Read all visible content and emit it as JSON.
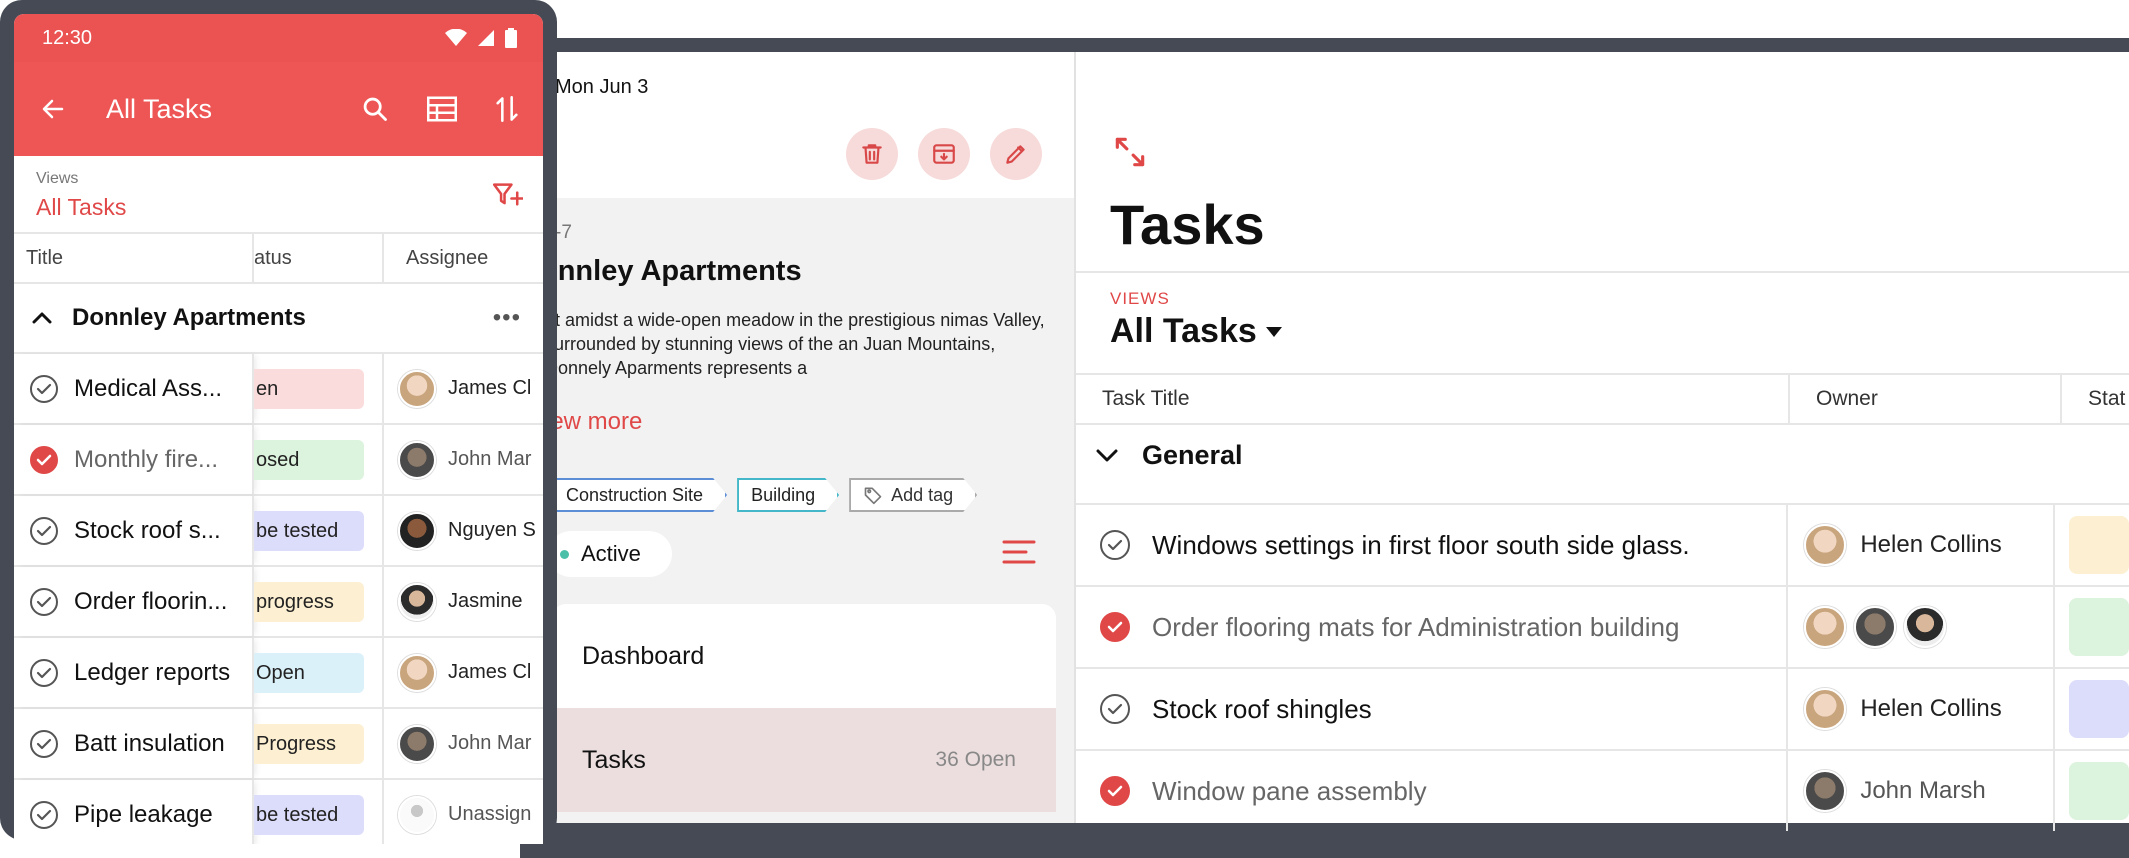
{
  "phone": {
    "status_bar": {
      "time": "12:30"
    },
    "app_bar": {
      "title": "All Tasks"
    },
    "views": {
      "label": "Views",
      "value": "All Tasks"
    },
    "columns": {
      "title": "Title",
      "status": "atus",
      "assignee": "Assignee"
    },
    "group": {
      "label": "Donnley Apartments",
      "more": "•••"
    },
    "rows": [
      {
        "title": "Medical Ass...",
        "done": false,
        "status": "en",
        "status_color": "#fbdcdc",
        "assignee": "James Cl",
        "avatar": "helen"
      },
      {
        "title": "Monthly fire...",
        "done": true,
        "status": "osed",
        "status_color": "#dcf3dd",
        "assignee": "John Mar",
        "avatar": "john"
      },
      {
        "title": "Stock roof s...",
        "done": false,
        "status": "be tested",
        "status_color": "#dcdcfb",
        "assignee": "Nguyen S",
        "avatar": "nguyen"
      },
      {
        "title": "Order floorin...",
        "done": false,
        "status": "progress",
        "status_color": "#fdf0d2",
        "assignee": "Jasmine",
        "avatar": "jas"
      },
      {
        "title": "Ledger reports",
        "done": false,
        "status": "Open",
        "status_color": "#daf1fa",
        "assignee": "James Cl",
        "avatar": "helen"
      },
      {
        "title": "Batt insulation",
        "done": false,
        "status": "Progress",
        "status_color": "#fdf0d2",
        "assignee": "John Mar",
        "avatar": "john"
      },
      {
        "title": "Pipe leakage",
        "done": false,
        "status": "be tested",
        "status_color": "#dcdcfb",
        "assignee": "Unassign",
        "avatar": "un"
      }
    ]
  },
  "project": {
    "date": "Mon Jun 3",
    "code": "-7",
    "title": "onnley Apartments",
    "description": "et amidst a wide-open meadow in the prestigious nimas Valley, surrounded by stunning views of the an Juan Mountains, Donnely Aparments represents a",
    "view_more": "iew more",
    "tags": [
      "Construction Site",
      "Building"
    ],
    "add_tag": "Add tag",
    "state": "Active",
    "nav": [
      {
        "label": "Dashboard",
        "count": "",
        "selected": false
      },
      {
        "label": "Tasks",
        "count": "36 Open",
        "selected": true
      }
    ]
  },
  "tasks": {
    "title": "Tasks",
    "views_label": "VIEWS",
    "views_value": "All Tasks",
    "columns": {
      "task_title": "Task Title",
      "owner": "Owner",
      "status": "Stat"
    },
    "group": "General",
    "rows": [
      {
        "title": "Windows settings in first floor south side glass.",
        "done": false,
        "owner": "Helen Collins",
        "avatars": [
          "helen"
        ],
        "status_color": "#fdf0d2"
      },
      {
        "title": "Order flooring mats for Administration building",
        "done": true,
        "owner": "",
        "avatars": [
          "helen",
          "john",
          "jas"
        ],
        "status_color": "#dcf3dd"
      },
      {
        "title": "Stock roof shingles",
        "done": false,
        "owner": "Helen Collins",
        "avatars": [
          "helen"
        ],
        "status_color": "#dcdcfb"
      },
      {
        "title": "Window pane assembly",
        "done": true,
        "owner": "John Marsh",
        "avatars": [
          "john"
        ],
        "status_color": "#dcf3dd"
      }
    ]
  },
  "colors": {
    "accent": "#eb5353",
    "accent_text": "#e04848",
    "frame": "#454a55"
  },
  "icons": {
    "back": "arrow-left-icon",
    "search": "search-icon",
    "table": "table-icon",
    "sort": "sort-icon",
    "filter": "filter-add-icon",
    "delete": "trash-icon",
    "archive": "archive-icon",
    "edit": "pencil-icon",
    "expand": "expand-icon",
    "menu": "menu-lines-icon",
    "tag_add": "tag-add-icon"
  }
}
